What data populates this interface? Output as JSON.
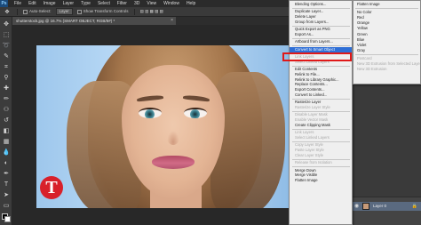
{
  "menubar": {
    "logo": "Ps",
    "items": [
      "File",
      "Edit",
      "Image",
      "Layer",
      "Type",
      "Select",
      "Filter",
      "3D",
      "View",
      "Window",
      "Help"
    ]
  },
  "options": {
    "auto_select": "Auto-Select:",
    "layer_select": "Layer",
    "show_transform": "Show Transform Controls"
  },
  "document": {
    "tab_title": "shutterstock.jpg @ 16.7% (SMART OBJECT, RGB/8#) *",
    "close_glyph": "×"
  },
  "context_menu": {
    "items": [
      {
        "label": "Blending Options...",
        "state": "enabled"
      },
      {
        "sep": true
      },
      {
        "label": "Duplicate Layer...",
        "state": "enabled"
      },
      {
        "label": "Delete Layer",
        "state": "enabled"
      },
      {
        "label": "Group from Layers...",
        "state": "enabled"
      },
      {
        "sep": true
      },
      {
        "label": "Quick Export as PNG",
        "state": "enabled"
      },
      {
        "label": "Export As...",
        "state": "enabled"
      },
      {
        "sep": true
      },
      {
        "label": "Artboard from Layers...",
        "state": "enabled"
      },
      {
        "sep": true
      },
      {
        "label": "Convert to Smart Object",
        "state": "highlight"
      },
      {
        "sep": true
      },
      {
        "label": "Link Layers",
        "state": "disabled"
      },
      {
        "label": "Select Linked Layers",
        "state": "disabled"
      },
      {
        "sep": true
      },
      {
        "label": "Edit Contents",
        "state": "enabled"
      },
      {
        "label": "Relink to File...",
        "state": "enabled"
      },
      {
        "label": "Relink to Library Graphic...",
        "state": "enabled"
      },
      {
        "label": "Replace Contents...",
        "state": "enabled"
      },
      {
        "label": "Export Contents...",
        "state": "enabled"
      },
      {
        "label": "Convert to Linked...",
        "state": "enabled"
      },
      {
        "sep": true
      },
      {
        "label": "Rasterize Layer",
        "state": "enabled"
      },
      {
        "label": "Rasterize Layer Style",
        "state": "disabled"
      },
      {
        "sep": true
      },
      {
        "label": "Disable Layer Mask",
        "state": "disabled"
      },
      {
        "label": "Enable Vector Mask",
        "state": "disabled"
      },
      {
        "label": "Create Clipping Mask",
        "state": "enabled"
      },
      {
        "sep": true
      },
      {
        "label": "Link Layers",
        "state": "disabled"
      },
      {
        "label": "Select Linked Layers",
        "state": "disabled"
      },
      {
        "sep": true
      },
      {
        "label": "Copy Layer Style",
        "state": "disabled"
      },
      {
        "label": "Paste Layer Style",
        "state": "disabled"
      },
      {
        "label": "Clear Layer Style",
        "state": "disabled"
      },
      {
        "sep": true
      },
      {
        "label": "Release from Isolation",
        "state": "disabled"
      },
      {
        "sep": true
      },
      {
        "label": "Merge Down",
        "state": "enabled"
      },
      {
        "label": "Merge Visible",
        "state": "enabled"
      },
      {
        "label": "Flatten Image",
        "state": "enabled"
      }
    ]
  },
  "submenu": {
    "items": [
      {
        "label": "Flatten Image",
        "state": "enabled"
      },
      {
        "sep": true
      },
      {
        "label": "No Color",
        "state": "enabled"
      },
      {
        "label": "Red",
        "state": "enabled"
      },
      {
        "label": "Orange",
        "state": "enabled"
      },
      {
        "label": "Yellow",
        "state": "enabled"
      },
      {
        "label": "Green",
        "state": "enabled"
      },
      {
        "label": "Blue",
        "state": "enabled"
      },
      {
        "label": "Violet",
        "state": "enabled"
      },
      {
        "label": "Gray",
        "state": "enabled"
      },
      {
        "sep": true
      },
      {
        "label": "Postcard",
        "state": "disabled"
      },
      {
        "label": "New 3D Extrusion from Selected Layer",
        "state": "disabled"
      },
      {
        "label": "New 3D Extrusion",
        "state": "disabled"
      }
    ]
  },
  "layers": {
    "layer_name": "Layer 0",
    "eye_glyph": "◉",
    "lock_glyph": "🔒"
  },
  "canvas": {
    "logo_letter": "T"
  },
  "colors": {
    "highlight": "#2f6fd6",
    "outline": "#e01818",
    "badge": "#d8202a"
  }
}
